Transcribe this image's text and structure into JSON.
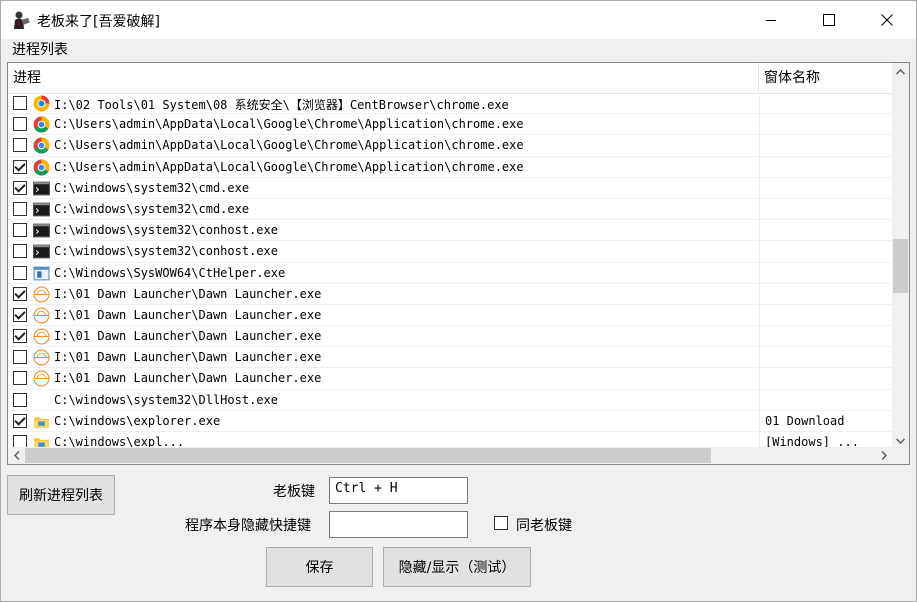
{
  "window": {
    "title": "老板来了[吾爱破解]"
  },
  "process_list": {
    "group_label": "进程列表",
    "columns": [
      "进程",
      "窗体名称"
    ],
    "rows": [
      {
        "checked": false,
        "icon": "centbrowser-icon",
        "path": "I:\\02 Tools\\01 System\\08 系统安全\\【浏览器】CentBrowser\\chrome.exe",
        "window_name": ""
      },
      {
        "checked": false,
        "icon": "chrome-icon",
        "path": "C:\\Users\\admin\\AppData\\Local\\Google\\Chrome\\Application\\chrome.exe",
        "window_name": ""
      },
      {
        "checked": false,
        "icon": "chrome-icon",
        "path": "C:\\Users\\admin\\AppData\\Local\\Google\\Chrome\\Application\\chrome.exe",
        "window_name": ""
      },
      {
        "checked": true,
        "icon": "chrome-icon",
        "path": "C:\\Users\\admin\\AppData\\Local\\Google\\Chrome\\Application\\chrome.exe",
        "window_name": ""
      },
      {
        "checked": true,
        "icon": "console-icon",
        "path": "C:\\windows\\system32\\cmd.exe",
        "window_name": ""
      },
      {
        "checked": false,
        "icon": "console-icon",
        "path": "C:\\windows\\system32\\cmd.exe",
        "window_name": ""
      },
      {
        "checked": false,
        "icon": "console-icon",
        "path": "C:\\windows\\system32\\conhost.exe",
        "window_name": ""
      },
      {
        "checked": false,
        "icon": "console-icon",
        "path": "C:\\windows\\system32\\conhost.exe",
        "window_name": ""
      },
      {
        "checked": false,
        "icon": "app-window-icon",
        "path": "C:\\Windows\\SysWOW64\\CtHelper.exe",
        "window_name": ""
      },
      {
        "checked": true,
        "icon": "dawn-launcher-icon",
        "path": "I:\\01 Dawn Launcher\\Dawn Launcher.exe",
        "window_name": ""
      },
      {
        "checked": true,
        "icon": "dawn-launcher-icon",
        "path": "I:\\01 Dawn Launcher\\Dawn Launcher.exe",
        "window_name": ""
      },
      {
        "checked": true,
        "icon": "dawn-launcher-icon",
        "path": "I:\\01 Dawn Launcher\\Dawn Launcher.exe",
        "window_name": ""
      },
      {
        "checked": false,
        "icon": "dawn-launcher-icon",
        "path": "I:\\01 Dawn Launcher\\Dawn Launcher.exe",
        "window_name": ""
      },
      {
        "checked": false,
        "icon": "dawn-launcher-icon",
        "path": "I:\\01 Dawn Launcher\\Dawn Launcher.exe",
        "window_name": ""
      },
      {
        "checked": false,
        "icon": "blank-icon",
        "path": "C:\\windows\\system32\\DllHost.exe",
        "window_name": ""
      },
      {
        "checked": true,
        "icon": "explorer-icon",
        "path": "C:\\windows\\explorer.exe",
        "window_name": "01 Download"
      },
      {
        "checked": false,
        "icon": "explorer-icon",
        "path": "C:\\windows\\expl...",
        "window_name": "[Windows] ..."
      }
    ]
  },
  "controls": {
    "refresh_label": "刷新进程列表",
    "boss_key_label": "老板键",
    "boss_key_value": "Ctrl + H",
    "self_hide_label": "程序本身隐藏快捷键",
    "self_hide_value": "",
    "same_as_boss_label": "同老板键",
    "save_label": "保存",
    "toggle_label": "隐藏/显示（测试）"
  }
}
